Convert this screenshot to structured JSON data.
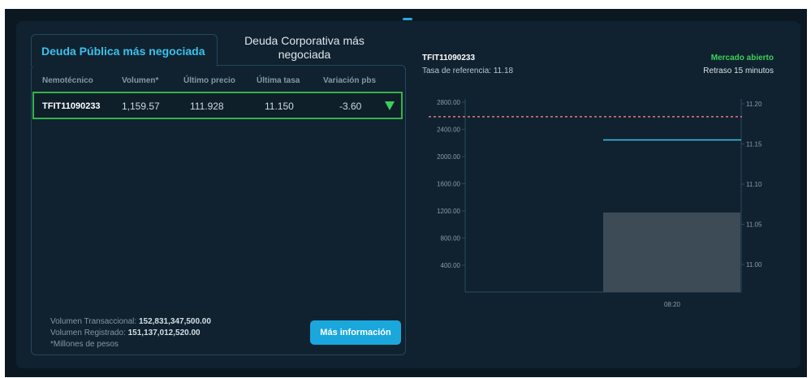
{
  "tabs": {
    "active": "Deuda Pública más negociada",
    "inactive": "Deuda Corporativa más negociada"
  },
  "table": {
    "headers": [
      "Nemotécnico",
      "Volumen*",
      "Último precio",
      "Última tasa",
      "Variación pbs"
    ],
    "rows": [
      {
        "code": "TFIT11090233",
        "volume": "1,159.57",
        "price": "111.928",
        "rate": "11.150",
        "variation": "-3.60",
        "direction": "down"
      }
    ]
  },
  "footer": {
    "transactional_label": "Volumen Transaccional:",
    "transactional_value": "152,831,347,500.00",
    "registered_label": "Volumen Registrado:",
    "registered_value": "151,137,012,520.00",
    "note": "*Millones de pesos",
    "more_button": "Más información"
  },
  "chart_header": {
    "instrument": "TFIT11090233",
    "reference_rate": "Tasa de referencia: 11.18",
    "market_status": "Mercado abierto",
    "delay": "Retraso 15 minutos"
  },
  "colors": {
    "accent": "#1aa7dc",
    "positive": "#3fd05a",
    "reference_line": "#e07a85",
    "rate_line": "#3cc1ee",
    "volume_bar": "#3c4b55"
  },
  "chart_data": {
    "type": "bar",
    "categories": [
      "08:20"
    ],
    "left_axis": {
      "ticks": [
        "2800.00",
        "2400.00",
        "2000.00",
        "1600.00",
        "1200.00",
        "800.00",
        "400.00"
      ],
      "ylim": [
        0,
        2880
      ]
    },
    "right_axis": {
      "ticks": [
        "11.20",
        "11.15",
        "11.10",
        "11.05",
        "11.00"
      ],
      "ylim": [
        10.953,
        11.203
      ]
    },
    "series": [
      {
        "kind": "volume-bar",
        "values": [
          1159.57
        ]
      },
      {
        "kind": "rate-line",
        "values": [
          11.15
        ]
      },
      {
        "kind": "reference-line",
        "values": [
          11.18
        ]
      }
    ]
  }
}
